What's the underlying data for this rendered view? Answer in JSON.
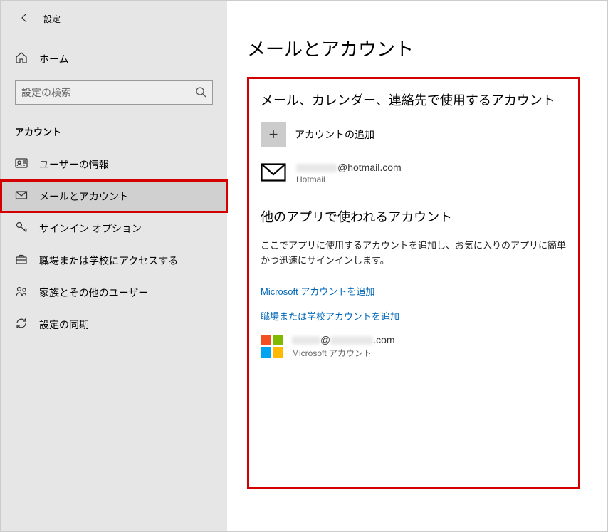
{
  "header": {
    "title": "設定"
  },
  "sidebar": {
    "home": "ホーム",
    "search_placeholder": "設定の検索",
    "section": "アカウント",
    "items": [
      {
        "label": "ユーザーの情報"
      },
      {
        "label": "メールとアカウント"
      },
      {
        "label": "サインイン オプション"
      },
      {
        "label": "職場または学校にアクセスする"
      },
      {
        "label": "家族とその他のユーザー"
      },
      {
        "label": "設定の同期"
      }
    ]
  },
  "main": {
    "title": "メールとアカウント",
    "section1_heading": "メール、カレンダー、連絡先で使用するアカウント",
    "add_account": "アカウントの追加",
    "hotmail_suffix": "@hotmail.com",
    "hotmail_type": "Hotmail",
    "section2_heading": "他のアプリで使われるアカウント",
    "section2_desc": "ここでアプリに使用するアカウントを追加し、お気に入りのアプリに簡単かつ迅速にサインインします。",
    "link_ms": "Microsoft アカウントを追加",
    "link_work": "職場または学校アカウントを追加",
    "ms_email_mid": "@",
    "ms_email_suffix": ".com",
    "ms_type": "Microsoft アカウント"
  }
}
